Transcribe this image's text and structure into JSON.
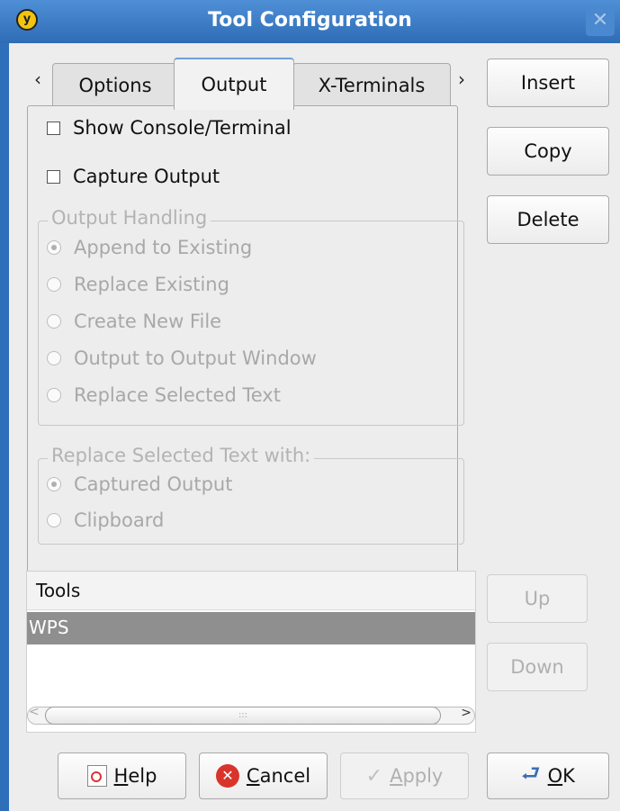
{
  "window": {
    "title": "Tool Configuration",
    "close_glyph": "✕",
    "app_icon": "y-logo-icon"
  },
  "tabs": {
    "left_arrow": "‹",
    "right_arrow": "›",
    "items": [
      {
        "label": "Options",
        "active": false
      },
      {
        "label": "Output",
        "active": true
      },
      {
        "label": "X-Terminals",
        "active": false
      }
    ]
  },
  "output": {
    "show_console": {
      "label": "Show Console/Terminal",
      "checked": false
    },
    "capture_output": {
      "label": "Capture Output",
      "checked": false
    },
    "handling": {
      "title": "Output Handling",
      "options": [
        {
          "label": "Append to Existing",
          "checked": true
        },
        {
          "label": "Replace Existing",
          "checked": false
        },
        {
          "label": "Create New File",
          "checked": false
        },
        {
          "label": "Output to Output Window",
          "checked": false
        },
        {
          "label": "Replace Selected Text",
          "checked": false
        }
      ]
    },
    "replace_with": {
      "title": "Replace Selected Text with:",
      "options": [
        {
          "label": "Captured Output",
          "checked": true
        },
        {
          "label": "Clipboard",
          "checked": false
        }
      ]
    }
  },
  "side_buttons": {
    "insert": "Insert",
    "copy": "Copy",
    "delete": "Delete",
    "up": "Up",
    "down": "Down"
  },
  "tools": {
    "header": "Tools",
    "items": [
      "WPS"
    ],
    "scroll_grip": ":::"
  },
  "bottom_buttons": {
    "help": {
      "pre": "",
      "mnemonic": "H",
      "post": "elp"
    },
    "cancel": {
      "pre": "",
      "mnemonic": "C",
      "post": "ancel"
    },
    "apply": {
      "pre": "",
      "mnemonic": "A",
      "post": "pply"
    },
    "ok": {
      "pre": "",
      "mnemonic": "O",
      "post": "K"
    }
  },
  "colors": {
    "titlebar": "#2e6db6",
    "selected_row": "#8f8f8f",
    "cancel_icon": "#d9342b"
  }
}
